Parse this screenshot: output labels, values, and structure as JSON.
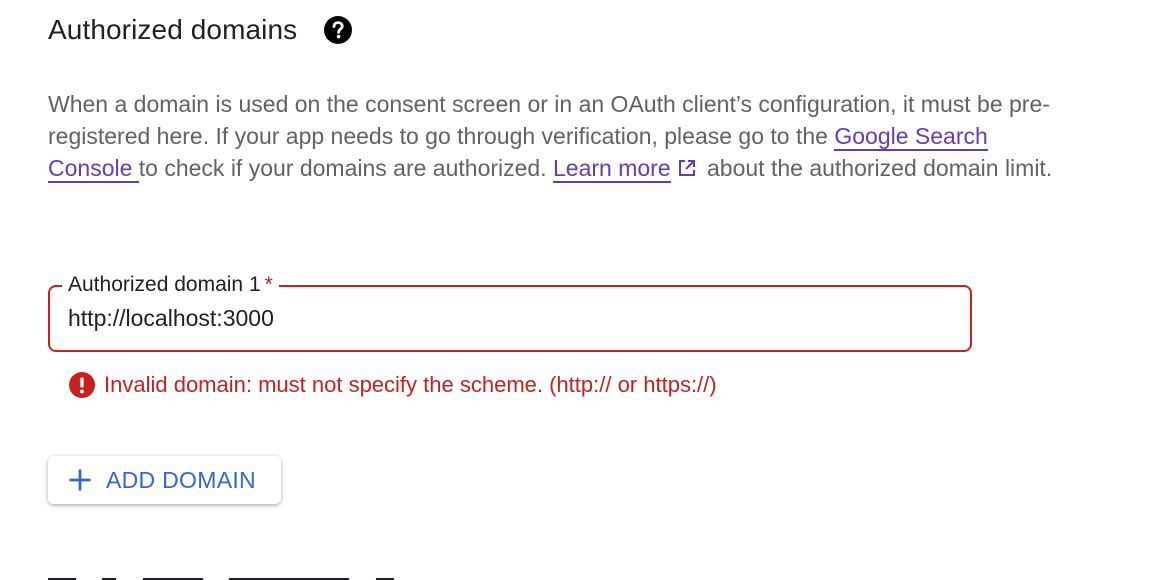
{
  "section": {
    "title": "Authorized domains",
    "help_icon": "help-circle-icon"
  },
  "description": {
    "part1": "When a domain is used on the consent screen or in an OAuth client’s configuration, it must be pre-registered here. If your app needs to go through verification, please go to the ",
    "link1": "Google Search Console ",
    "part2": "to check if your domains are authorized. ",
    "link2": "Learn more",
    "link2_icon": "open-in-new-icon",
    "part3": " about the authorized domain limit."
  },
  "field": {
    "label": "Authorized domain 1",
    "required_mark": "*",
    "value": "http://localhost:3000"
  },
  "error": {
    "icon": "error-icon",
    "message": "Invalid domain: must not specify the scheme. (http:// or https://)"
  },
  "add_button": {
    "icon": "plus-icon",
    "label": "ADD DOMAIN"
  },
  "colors": {
    "error": "#c5221f",
    "link": "#673ab7",
    "accent": "#3367d6",
    "text": "#202124",
    "secondary_text": "#5f6368"
  }
}
